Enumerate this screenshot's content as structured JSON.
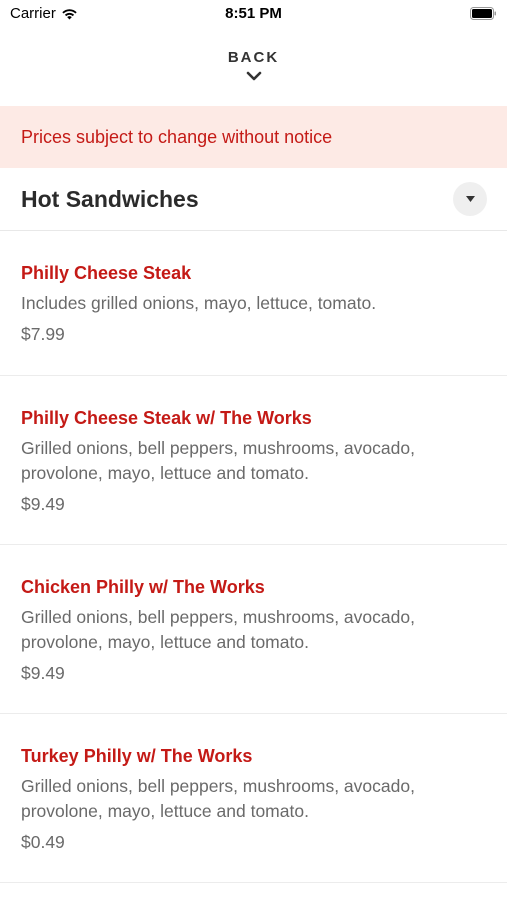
{
  "status_bar": {
    "carrier": "Carrier",
    "time": "8:51 PM"
  },
  "nav": {
    "back_label": "BACK"
  },
  "notice": {
    "text": "Prices subject to change without notice"
  },
  "section": {
    "title": "Hot Sandwiches"
  },
  "items": [
    {
      "name": "Philly Cheese Steak",
      "description": "Includes grilled onions, mayo, lettuce, tomato.",
      "price": "$7.99"
    },
    {
      "name": "Philly Cheese Steak w/ The Works",
      "description": "Grilled onions, bell peppers, mushrooms, avocado, provolone, mayo, lettuce and tomato.",
      "price": "$9.49"
    },
    {
      "name": "Chicken Philly w/ The Works",
      "description": "Grilled onions, bell peppers, mushrooms, avocado, provolone, mayo, lettuce and tomato.",
      "price": "$9.49"
    },
    {
      "name": "Turkey Philly w/ The Works",
      "description": "Grilled onions, bell peppers, mushrooms, avocado, provolone, mayo, lettuce and tomato.",
      "price": "$0.49"
    }
  ],
  "colors": {
    "accent": "#c41a16",
    "notice_bg": "#fdeae5"
  }
}
